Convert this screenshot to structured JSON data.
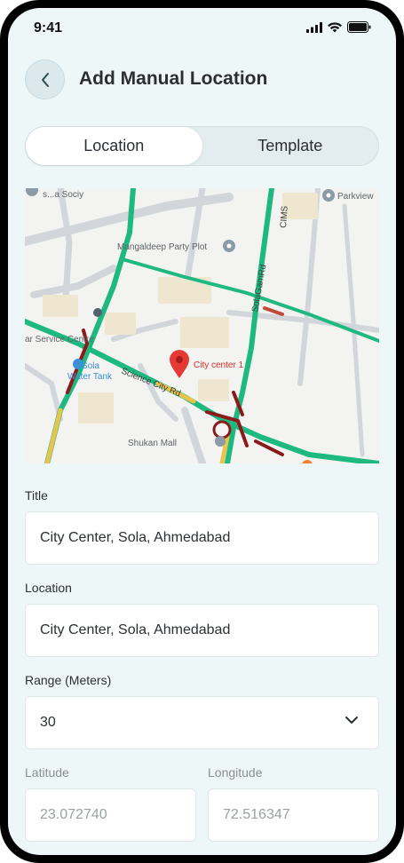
{
  "status": {
    "time": "9:41"
  },
  "header": {
    "title": "Add Manual Location"
  },
  "tabs": [
    {
      "label": "Location",
      "active": true
    },
    {
      "label": "Template",
      "active": false
    }
  ],
  "map": {
    "marker_label": "City center 1",
    "labels": {
      "party_plot": "Mangaldeep Party Plot",
      "parkview": "Parkview",
      "sola_road": "SolaGamRd",
      "cims": "CIMS",
      "science_city": "Science City Rd",
      "shukan": "Shukan Mall",
      "service": "ar Service Centre",
      "water_tank_1": "Sola",
      "water_tank_2": "Water Tank",
      "top_left": "s...a Sociy"
    }
  },
  "form": {
    "title_label": "Title",
    "title_value": "City Center, Sola, Ahmedabad",
    "location_label": "Location",
    "location_value": "City Center, Sola, Ahmedabad",
    "range_label": "Range (Meters)",
    "range_value": "30",
    "latitude_label": "Latitude",
    "latitude_value": "23.072740",
    "longitude_label": "Longitude",
    "longitude_value": "72.516347"
  },
  "colors": {
    "screen_bg": "#eef7f8",
    "road_green": "#1eb980",
    "road_red": "#8b1a1a",
    "road_yellow": "#e9c44a",
    "marker": "#e53935"
  }
}
